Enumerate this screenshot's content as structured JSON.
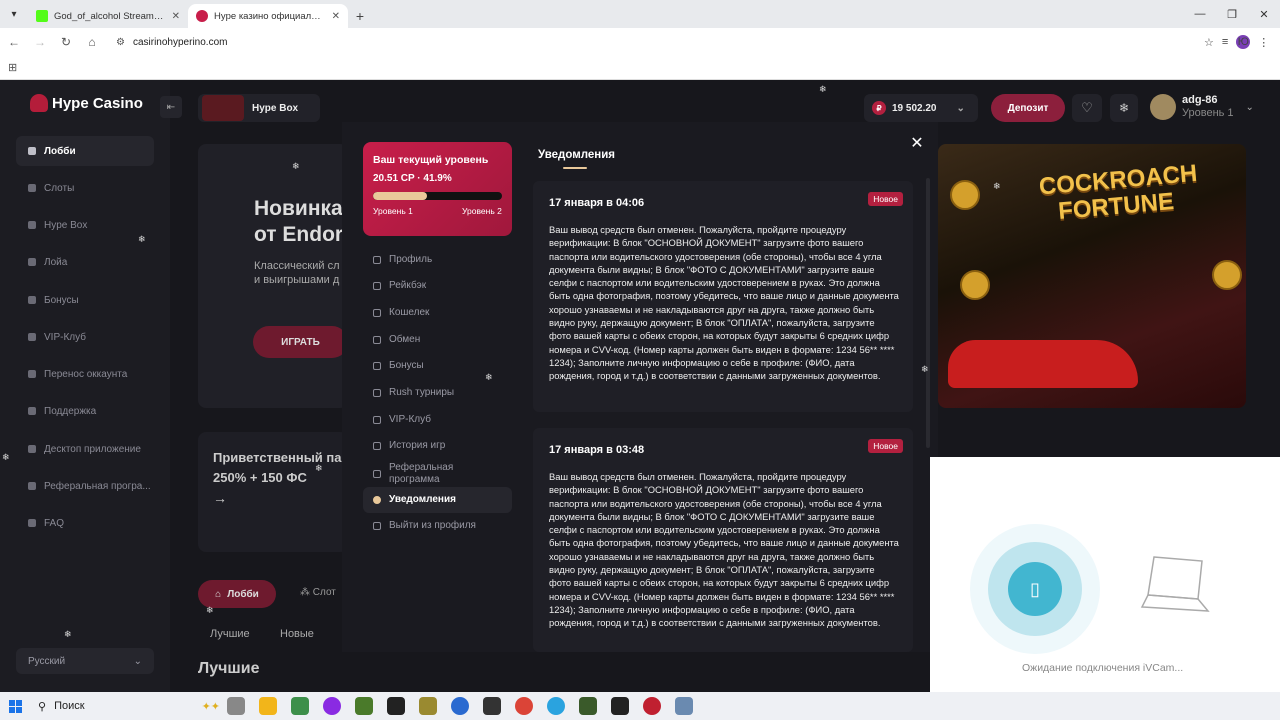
{
  "browser": {
    "tabs": [
      {
        "title": "God_of_alcohol Stream - Watch",
        "active": false
      },
      {
        "title": "Hype казино официальный сай",
        "active": true
      }
    ],
    "url": "casirinohyperino.com",
    "new_tab": "+",
    "profile_initial": "Ю"
  },
  "site": {
    "logo": "Hype Casino",
    "hype_box_label": "Hype Box",
    "balance": "19 502.20",
    "currency_symbol": "₽",
    "deposit_label": "Депозит",
    "user": {
      "name": "adg-86",
      "level": "Уровень 1"
    },
    "sidebar": [
      {
        "label": "Лобби",
        "active": true
      },
      {
        "label": "Слоты"
      },
      {
        "label": "Hype Box"
      },
      {
        "label": "Лойа"
      },
      {
        "label": "Бонусы"
      },
      {
        "label": "VIP-Клуб"
      },
      {
        "label": "Перенос оккаунта"
      },
      {
        "label": "Поддержка"
      },
      {
        "label": "Десктоп приложение"
      },
      {
        "label": "Реферальная програ..."
      },
      {
        "label": "FAQ"
      }
    ],
    "language": "Русский",
    "hero": {
      "title_line1": "Новинка",
      "title_line2": "от Endorp",
      "sub_line1": "Классический сл",
      "sub_line2": "и выигрышами д",
      "play_label": "ИГРАТЬ"
    },
    "promo": {
      "line1": "Приветственный па",
      "line2": "250% + 150 ФС"
    },
    "lobby_tabs": {
      "lobby": "Лобби",
      "slots": "Слот"
    },
    "filters": {
      "best": "Лучшие",
      "new": "Новые"
    },
    "best_heading": "Лучшие",
    "game_banner_title": "COCKROACH FORTUNE"
  },
  "modal": {
    "level_card": {
      "title": "Ваш текущий уровень",
      "cp": "20.51 CP · 41.9%",
      "progress": 0.419,
      "from_level": "Уровень 1",
      "to_level": "Уровень 2"
    },
    "menu": [
      {
        "label": "Профиль",
        "active": false
      },
      {
        "label": "Рейкбэк",
        "active": false
      },
      {
        "label": "Кошелек",
        "active": false
      },
      {
        "label": "Обмен",
        "active": false
      },
      {
        "label": "Бонусы",
        "active": false
      },
      {
        "label": "Rush турниры",
        "active": false
      },
      {
        "label": "VIP-Клуб",
        "active": false
      },
      {
        "label": "История игр",
        "active": false
      },
      {
        "label": "Реферальная программа",
        "active": false
      },
      {
        "label": "Уведомления",
        "active": true
      },
      {
        "label": "Выйти из профиля",
        "active": false
      }
    ],
    "notifications_title": "Уведомления",
    "notifications": [
      {
        "date": "17 января в 04:06",
        "badge": "Новое",
        "text": "Ваш вывод средств был отменен. Пожалуйста, пройдите процедуру верификации: В блок \"ОСНОВНОЙ ДОКУМЕНТ\" загрузите фото вашего паспорта или водительского удостоверения (обе стороны), чтобы все 4 угла документа были видны; В блок \"ФОТО С ДОКУМЕНТАМИ\" загрузите ваше селфи с паспортом или водительским удостоверением в руках. Это должна быть одна фотография, поэтому убедитесь, что ваше лицо и данные документа хорошо узнаваемы и не накладываются друг на друга, также должно быть видно руку, держащую документ; В блок \"ОПЛАТА\", пожалуйста, загрузите фото вашей карты с обеих сторон, на которых будут закрыты 6 средних цифр номера и CVV-код. (Номер карты должен быть виден в формате: 1234 56** **** 1234); Заполните личную информацию о себе в профиле: (ФИО, дата рождения, город и т.д.) в соответствии с данными загруженных документов."
      },
      {
        "date": "17 января в 03:48",
        "badge": "Новое",
        "text": "Ваш вывод средств был отменен. Пожалуйста, пройдите процедуру верификации: В блок \"ОСНОВНОЙ ДОКУМЕНТ\" загрузите фото вашего паспорта или водительского удостоверения (обе стороны), чтобы все 4 угла документа были видны; В блок \"ФОТО С ДОКУМЕНТАМИ\" загрузите ваше селфи с паспортом или водительским удостоверением в руках. Это должна быть одна фотография, поэтому убедитесь, что ваше лицо и данные документа хорошо узнаваемы и не накладываются друг на друга, также должно быть видно руку, держащую документ; В блок \"ОПЛАТА\", пожалуйста, загрузите фото вашей карты с обеих сторон, на которых будут закрыты 6 средних цифр номера и CVV-код. (Номер карты должен быть виден в формате: 1234 56** **** 1234); Заполните личную информацию о себе в профиле: (ФИО, дата рождения, город и т.д.) в соответствии с данными загруженных документов."
      }
    ]
  },
  "ivcam": {
    "status": "Ожидание подключения iVCam..."
  },
  "taskbar": {
    "search_label": "Поиск"
  },
  "colors": {
    "accent": "#b3203f",
    "gold": "#e9c89a",
    "bg": "#17171c"
  }
}
